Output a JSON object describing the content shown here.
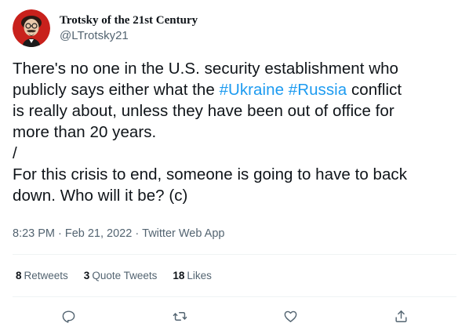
{
  "author": {
    "display_name": "Trotsky of the 21st Century",
    "handle": "@LTrotsky21"
  },
  "tweet": {
    "lines": [
      [
        {
          "text": "There's no one in the U.S. security establishment who"
        }
      ],
      [
        {
          "text": "publicly says either what the "
        },
        {
          "text": "#Ukraine",
          "hashtag": true
        },
        {
          "text": " "
        },
        {
          "text": "#Russia",
          "hashtag": true
        },
        {
          "text": " conflict"
        }
      ],
      [
        {
          "text": "is really about, unless they have been out of office for"
        }
      ],
      [
        {
          "text": "more than 20 years."
        }
      ],
      [
        {
          "text": "/"
        }
      ],
      [
        {
          "text": "For this crisis to end, someone is going to have to back"
        }
      ],
      [
        {
          "text": "down. Who will it be? (c)"
        }
      ]
    ],
    "time": "8:23 PM",
    "separator": "·",
    "date": "Feb 21, 2022",
    "source": "Twitter Web App"
  },
  "stats": {
    "retweets_count": "8",
    "retweets_label": "Retweets",
    "quotes_count": "3",
    "quotes_label": "Quote Tweets",
    "likes_count": "18",
    "likes_label": "Likes"
  },
  "actions": {
    "reply_icon": "reply-icon",
    "retweet_icon": "retweet-icon",
    "like_icon": "like-icon",
    "share_icon": "share-icon"
  },
  "colors": {
    "hashtag": "#1d9bf0",
    "text": "#0f1419",
    "secondary": "#536471",
    "divider": "#eff3f4",
    "avatar_bg": "#c8211c"
  }
}
